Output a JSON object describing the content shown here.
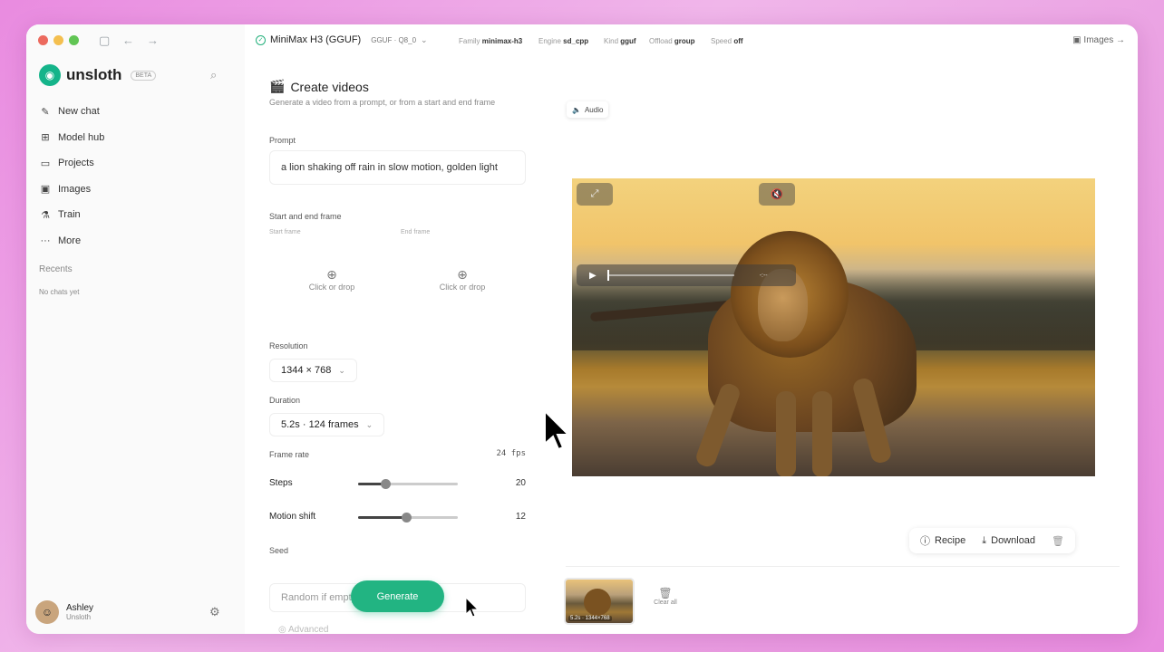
{
  "sidebar": {
    "brand": "unsloth",
    "beta": "BETA",
    "items": [
      {
        "label": "New chat",
        "icon": "edit-icon"
      },
      {
        "label": "Model hub",
        "icon": "grid-icon"
      },
      {
        "label": "Projects",
        "icon": "folder-icon"
      },
      {
        "label": "Images",
        "icon": "image-icon"
      },
      {
        "label": "Train",
        "icon": "flask-icon"
      },
      {
        "label": "More",
        "icon": "more-icon"
      }
    ],
    "recents_label": "Recents",
    "no_chats": "No chats yet",
    "user_name": "Ashley",
    "user_org": "Unsloth"
  },
  "topbar": {
    "model_name": "MiniMax H3 (GGUF)",
    "quant": "GGUF · Q8_0",
    "family_label": "Family",
    "family_value": "minimax-h3",
    "engine_label": "Engine",
    "engine_value": "sd_cpp",
    "kind_label": "Kind",
    "kind_value": "gguf",
    "offload_label": "Offload",
    "offload_value": "group",
    "speed_label": "Speed",
    "speed_value": "off",
    "images_link": "Images"
  },
  "form": {
    "title": "Create videos",
    "subtitle": "Generate a video from a prompt, or from a start and end frame",
    "prompt_label": "Prompt",
    "prompt_value": "a lion shaking off rain in slow motion, golden light",
    "frames_label": "Start and end frame",
    "start_frame_label": "Start frame",
    "end_frame_label": "End frame",
    "drop_text": "Click or drop",
    "resolution_label": "Resolution",
    "resolution_value": "1344 × 768",
    "duration_label": "Duration",
    "duration_value": "5.2s · 124 frames",
    "framerate_label": "Frame rate",
    "framerate_value": "24 fps",
    "steps_label": "Steps",
    "steps_value": "20",
    "steps_fraction": 0.27,
    "motion_label": "Motion shift",
    "motion_value": "12",
    "motion_fraction": 0.48,
    "seed_label": "Seed",
    "seed_placeholder": "Random if empty",
    "advanced_label": "Advanced",
    "generate_label": "Generate"
  },
  "preview": {
    "audio_label": "Audio",
    "video_time": "-:--",
    "recipe_label": "Recipe",
    "download_label": "Download",
    "thumb_label": "5.2s · 1344×768",
    "clear_all": "Clear all"
  }
}
